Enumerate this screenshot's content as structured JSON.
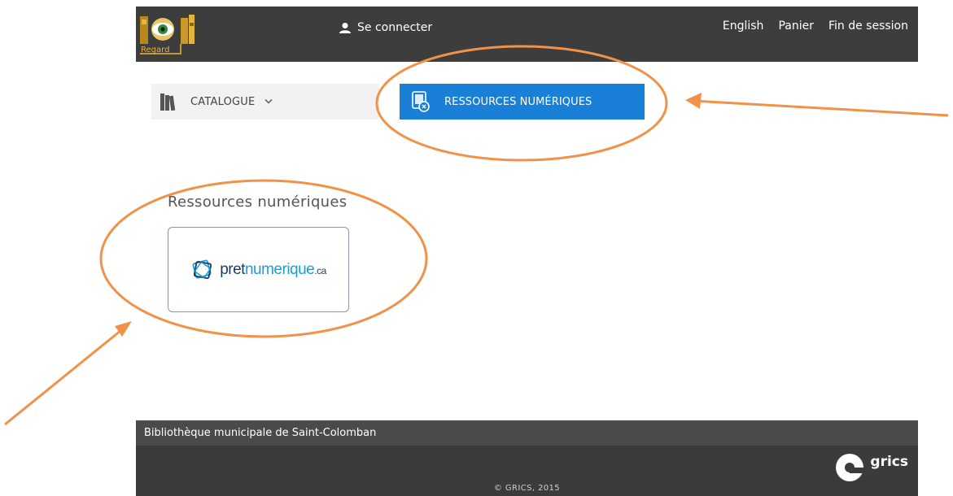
{
  "header": {
    "logo_text": "Regard",
    "login_label": "Se connecter",
    "links": [
      "English",
      "Panier",
      "Fin de session"
    ]
  },
  "nav": {
    "catalogue_label": "CATALOGUE",
    "ressources_label": "RESSOURCES NUMÉRIQUES"
  },
  "main": {
    "section_title": "Ressources numériques",
    "resource": {
      "logo_part1": "pret",
      "logo_part2": "numerique",
      "logo_part3": ".ca"
    }
  },
  "footer": {
    "library_name": "Bibliothèque municipale de Saint-Colomban",
    "copyright": "© GRICS, 2015",
    "brand": "grics"
  },
  "colors": {
    "topbar": "#3d3d3d",
    "active_tab": "#1a7fd6",
    "annotation": "#f0924a",
    "footer": "#3b3b3b"
  }
}
